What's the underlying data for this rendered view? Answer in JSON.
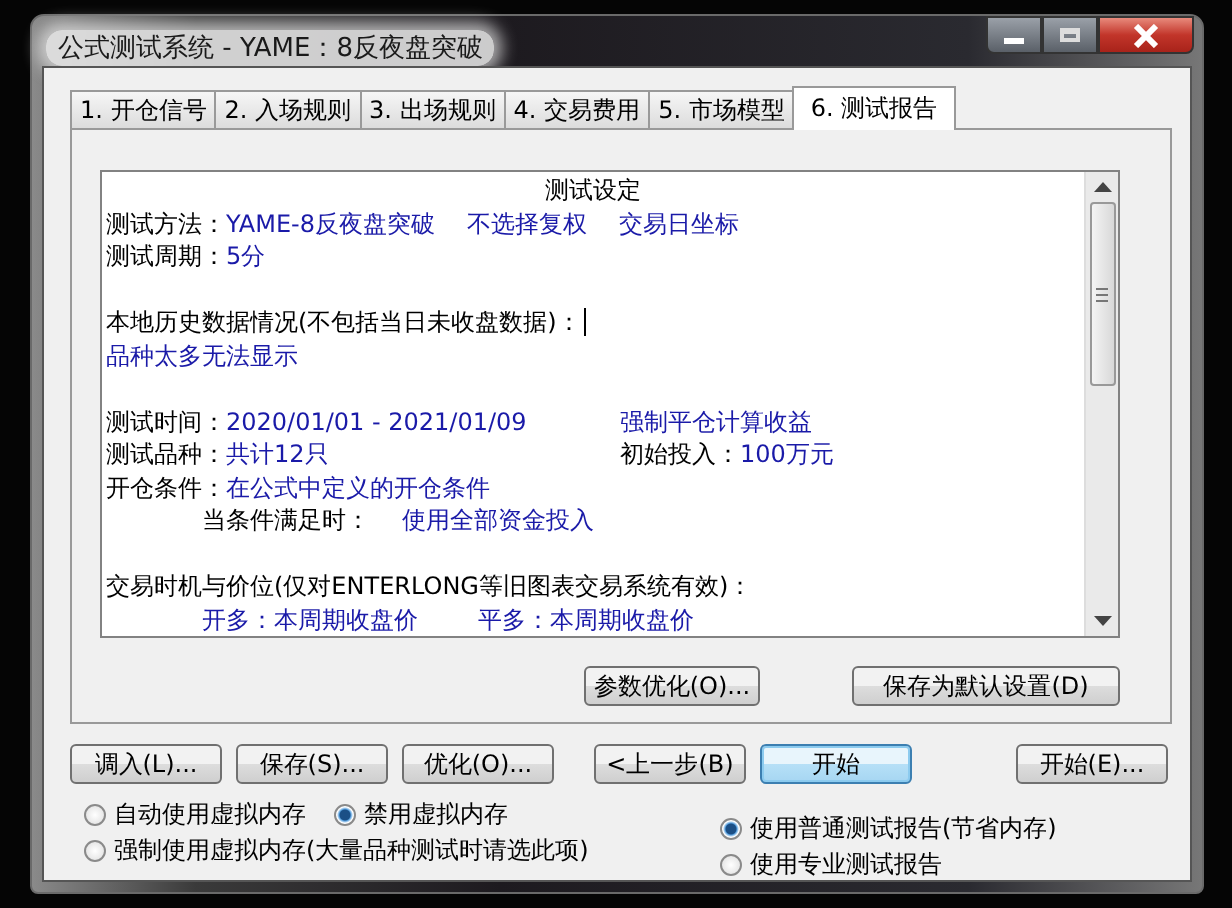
{
  "window": {
    "title": "公式测试系统 - YAME：8反夜盘突破"
  },
  "tabs": [
    {
      "label": "1. 开仓信号",
      "selected": false
    },
    {
      "label": "2. 入场规则",
      "selected": false
    },
    {
      "label": "3. 出场规则",
      "selected": false
    },
    {
      "label": "4. 交易费用",
      "selected": false
    },
    {
      "label": "5. 市场模型",
      "selected": false
    },
    {
      "label": "6. 测试报告",
      "selected": true
    }
  ],
  "report": {
    "heading": "测试设定",
    "lines": [
      {
        "kind": "plain",
        "runs": [
          {
            "text": "测试方法：",
            "kind": "label"
          },
          {
            "text": "YAME-8反夜盘突破",
            "kind": "value"
          },
          {
            "text": "不选择复权",
            "kind": "value"
          },
          {
            "text": "交易日坐标",
            "kind": "value"
          }
        ]
      },
      {
        "kind": "plain",
        "runs": [
          {
            "text": "测试周期：",
            "kind": "label"
          },
          {
            "text": "5分",
            "kind": "value"
          }
        ]
      },
      {
        "kind": "blank"
      },
      {
        "kind": "plain",
        "cursor": true,
        "runs": [
          {
            "text": "本地历史数据情况(不包括当日未收盘数据)：",
            "kind": "label"
          }
        ]
      },
      {
        "kind": "plain",
        "runs": [
          {
            "text": "品种太多无法显示",
            "kind": "value"
          }
        ]
      },
      {
        "kind": "blank"
      },
      {
        "kind": "plain",
        "runs": [
          {
            "text": "测试时间：",
            "kind": "label"
          },
          {
            "text": "2020/01/01 - 2021/01/09",
            "kind": "value"
          }
        ],
        "right_runs": [
          {
            "text": "强制平仓计算收益",
            "kind": "value"
          }
        ]
      },
      {
        "kind": "plain",
        "runs": [
          {
            "text": "测试品种：",
            "kind": "label"
          },
          {
            "text": "共计12只",
            "kind": "value"
          }
        ],
        "right_runs": [
          {
            "text": "初始投入：",
            "kind": "label"
          },
          {
            "text": "100万元",
            "kind": "value"
          }
        ]
      },
      {
        "kind": "plain",
        "runs": [
          {
            "text": "开仓条件：",
            "kind": "label"
          },
          {
            "text": "在公式中定义的开仓条件",
            "kind": "value"
          }
        ]
      },
      {
        "kind": "indented",
        "runs": [
          {
            "text": "当条件满足时：",
            "kind": "label"
          },
          {
            "text": "使用全部资金投入",
            "kind": "value"
          }
        ]
      },
      {
        "kind": "blank"
      },
      {
        "kind": "plain",
        "runs": [
          {
            "text": "交易时机与价位(仅对ENTERLONG等旧图表交易系统有效)：",
            "kind": "label"
          }
        ]
      },
      {
        "kind": "indented",
        "runs": [
          {
            "text": "开多：本周期收盘价",
            "kind": "value"
          },
          {
            "text": "平多：本周期收盘价",
            "kind": "value"
          }
        ]
      }
    ]
  },
  "panel_buttons": [
    "参数优化(O)...",
    "保存为默认设置(D)"
  ],
  "button_groups": [
    [
      {
        "label": "调入(L)...",
        "default": false
      },
      {
        "label": "保存(S)...",
        "default": false
      },
      {
        "label": "优化(O)...",
        "default": false
      }
    ],
    [
      {
        "label": "<上一步(B)",
        "default": false
      },
      {
        "label": "开始",
        "default": true
      }
    ],
    [
      {
        "label": "开始(E)...",
        "default": false
      }
    ]
  ],
  "memory_options": [
    {
      "label": "自动使用虚拟内存",
      "selected": false
    },
    {
      "label": "禁用虚拟内存",
      "selected": true
    },
    {
      "label": "强制使用虚拟内存(大量品种测试时请选此项)",
      "selected": false
    }
  ],
  "report_options": [
    {
      "label": "使用普通测试报告(节省内存)",
      "selected": true
    },
    {
      "label": "使用专业测试报告",
      "selected": false
    }
  ]
}
